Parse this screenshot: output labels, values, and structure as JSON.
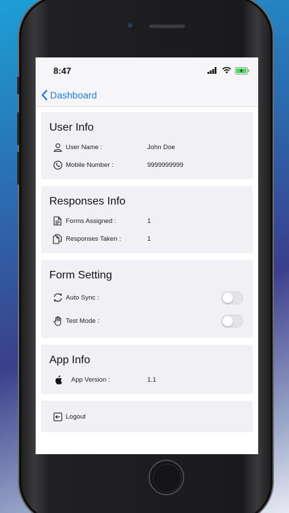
{
  "status_bar": {
    "time": "8:47"
  },
  "nav": {
    "back_label": "Dashboard"
  },
  "user_info": {
    "title": "User Info",
    "rows": [
      {
        "label": "User Name :",
        "value": "John Doe",
        "icon": "person-icon"
      },
      {
        "label": "Mobile Number :",
        "value": "9999999999",
        "icon": "phone-icon"
      }
    ]
  },
  "responses_info": {
    "title": "Responses Info",
    "rows": [
      {
        "label": "Forms Assigned :",
        "value": "1",
        "icon": "document-icon"
      },
      {
        "label": "Responses Taken :",
        "value": "1",
        "icon": "documents-icon"
      }
    ]
  },
  "form_setting": {
    "title": "Form Setting",
    "rows": [
      {
        "label": "Auto Sync :",
        "icon": "sync-icon",
        "enabled": false
      },
      {
        "label": "Test Mode :",
        "icon": "hand-icon",
        "enabled": false
      }
    ]
  },
  "app_info": {
    "title": "App Info",
    "rows": [
      {
        "label": "App Version :",
        "value": "1.1",
        "icon": "apple-icon"
      }
    ]
  },
  "logout": {
    "label": "Logout",
    "icon": "logout-icon"
  },
  "colors": {
    "accent": "#1f7ad6",
    "card_bg": "#f1f1f5",
    "battery": "#4cd964"
  }
}
